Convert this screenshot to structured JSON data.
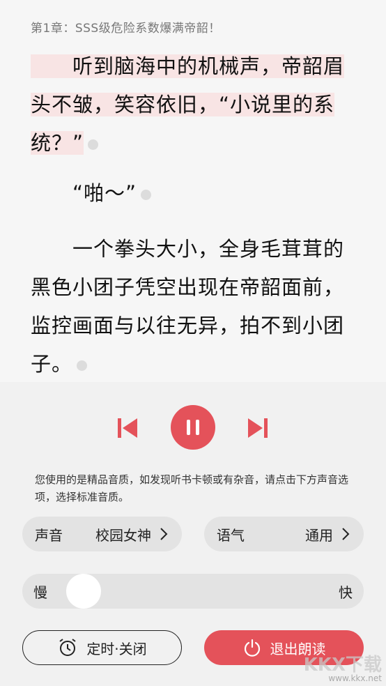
{
  "reader": {
    "chapter_title": "第1章：SSS级危险系数爆满帝韶！",
    "para1_line1": "　　听到脑海中的机械声，帝韶眉",
    "para1_line2": "头不皱，笑容依旧，“小说里的系",
    "para1_line3": "统？”",
    "para2": "　　“啪～”",
    "para3_line1": "　　一个拳头大小，全身毛茸茸的",
    "para3_line2": "黑色小团子凭空出现在帝韶面前，",
    "para3_line3": "监控画面与以往无异，拍不到小团",
    "para3_line4": "子。"
  },
  "player": {
    "notice": "您使用的是精品音质，如发现听书卡顿或有杂音，请点击下方声音选项，选择标准音质。",
    "voice_label": "声音",
    "voice_value": "校园女神",
    "tone_label": "语气",
    "tone_value": "通用",
    "speed_slow": "慢",
    "speed_fast": "快",
    "speed_level": 0.1,
    "timer_label": "定时·关闭",
    "exit_label": "退出朗读",
    "accent_color": "#e4525a"
  },
  "watermark": {
    "brand": "KKX下载",
    "url": "www.kkx.net"
  }
}
